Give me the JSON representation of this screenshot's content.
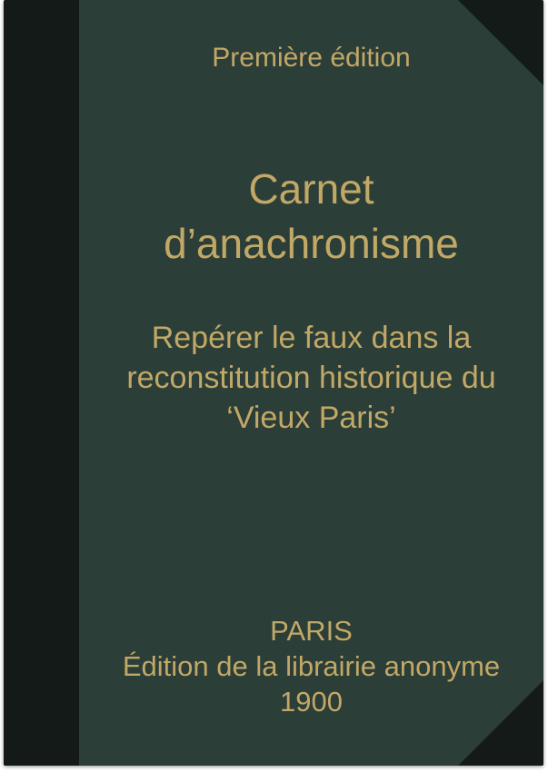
{
  "cover": {
    "edition": "Première édition",
    "title_lines": [
      "Carnet",
      "d’anachronisme"
    ],
    "subtitle_lines": [
      "Repérer le faux dans la",
      "reconstitution historique du",
      "‘Vieux Paris’"
    ],
    "imprint_lines": [
      "PARIS",
      "Édition de la librairie anonyme",
      "1900"
    ]
  },
  "colors": {
    "cover_background": "#2c3e38",
    "spine_and_corners": "#141a17",
    "lettering": "#c2a867"
  }
}
